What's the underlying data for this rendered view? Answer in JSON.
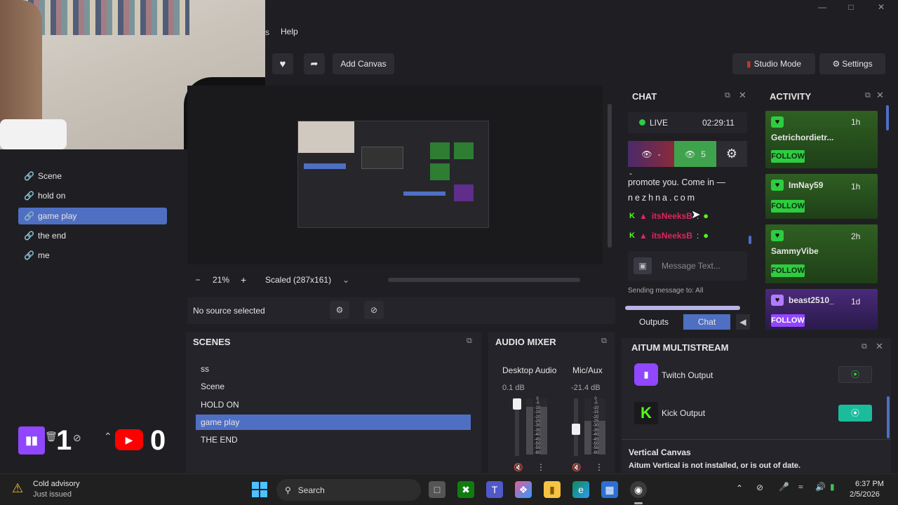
{
  "menu": {
    "help": "Help",
    "partial": "s"
  },
  "toolbar": {
    "add_canvas": "Add Canvas",
    "studio_mode": "Studio Mode",
    "settings": "Settings"
  },
  "left_scenes": [
    {
      "label": "Scene"
    },
    {
      "label": "hold on"
    },
    {
      "label": "game play",
      "active": true
    },
    {
      "label": "the end"
    },
    {
      "label": "me"
    }
  ],
  "overlay": {
    "twitch_count": "1",
    "youtube_count": "0"
  },
  "zoom": {
    "minus": "−",
    "value": "21%",
    "plus": "+",
    "scale": "Scaled (287x161)"
  },
  "source": {
    "text": "No source selected"
  },
  "scenes_panel": {
    "title": "SCENES",
    "items": [
      {
        "label": "ss"
      },
      {
        "label": "Scene"
      },
      {
        "label": "HOLD ON"
      },
      {
        "label": "game play",
        "active": true
      },
      {
        "label": "THE END"
      }
    ]
  },
  "mixer": {
    "title": "AUDIO MIXER",
    "channels": [
      {
        "name": "Desktop Audio",
        "db": "0.1 dB",
        "level": 0.85
      },
      {
        "name": "Mic/Aux",
        "db": "-21.4 dB",
        "level": 0.45
      }
    ],
    "ticks": [
      "0",
      "-5",
      "-10",
      "-15",
      "-20",
      "-25",
      "-30",
      "-35",
      "-40",
      "-45",
      "-50",
      "-55",
      "-60"
    ]
  },
  "chat": {
    "title": "CHAT",
    "live_label": "LIVE",
    "timer": "02:29:11",
    "hidden_viewers": "-",
    "viewers": "5",
    "dash_line": "-",
    "message_line1": "promote you. Come in —",
    "message_line2": "nezhna.com",
    "user1": "itsNeeksB",
    "user2": "itsNeeksB",
    "input_placeholder": "Message Text...",
    "sending_to": "Sending message to: All",
    "tab_outputs": "Outputs",
    "tab_chat": "Chat"
  },
  "activity": {
    "title": "ACTIVITY",
    "items": [
      {
        "name": "Getrichordietr...",
        "time": "1h",
        "button": "FOLLOW",
        "color": "#2ecc40"
      },
      {
        "name": "ImNay59",
        "time": "1h",
        "button": "FOLLOW",
        "color": "#2ecc40"
      },
      {
        "name": "SammyVibe",
        "time": "2h",
        "button": "FOLLOW",
        "color": "#2ecc40"
      },
      {
        "name": "beast2510_",
        "time": "1d",
        "button": "FOLLOW",
        "color": "#9146ff"
      }
    ]
  },
  "multistream": {
    "title": "AITUM MULTISTREAM",
    "outputs": [
      {
        "name": "Twitch Output",
        "active": false
      },
      {
        "name": "Kick Output",
        "active": true
      }
    ],
    "vertical_title": "Vertical Canvas",
    "vertical_note": "Aitum Vertical is not installed, or is out of date."
  },
  "taskbar": {
    "weather_title": "Cold advisory",
    "weather_sub": "Just issued",
    "search": "Search",
    "time": "6:37 PM",
    "date": "2/5/2026"
  },
  "colors": {
    "accent": "#4f6fc3",
    "kick": "#53fc18",
    "twitch": "#9146ff",
    "follow": "#2ecc40"
  }
}
